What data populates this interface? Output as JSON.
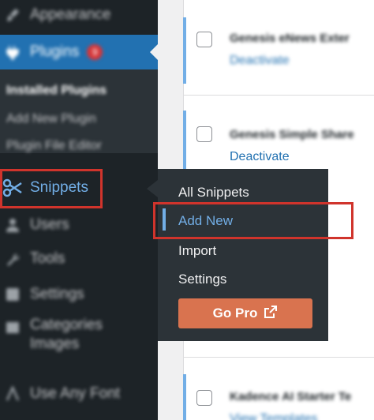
{
  "menu": {
    "appearance": "Appearance",
    "plugins": "Plugins",
    "plugins_badge": "9",
    "plugins_submenu": [
      "Installed Plugins",
      "Add New Plugin",
      "Plugin File Editor"
    ],
    "snippets": "Snippets",
    "users": "Users",
    "tools": "Tools",
    "settings": "Settings",
    "categories_line1": "Categories",
    "categories_line2": "Images",
    "any_font": "Use Any Font"
  },
  "flyout": {
    "items": [
      "All Snippets",
      "Add New",
      "Import",
      "Settings"
    ],
    "current": "Add New",
    "go_pro": "Go Pro"
  },
  "plugins_list": [
    {
      "name": "Genesis eNews Exter",
      "action": "Deactivate"
    },
    {
      "name": "Genesis Simple Share",
      "action": "Deactivate"
    },
    {
      "name": "Kadence AI Starter Te",
      "action": "View Templates"
    }
  ],
  "colors": {
    "menu_bg": "#1d2327",
    "submenu_bg": "#2c3338",
    "accent_blue": "#2271b1",
    "link_blue": "#72aee6",
    "highlight_red": "#d0342c",
    "go_pro_orange": "#d9734f"
  }
}
